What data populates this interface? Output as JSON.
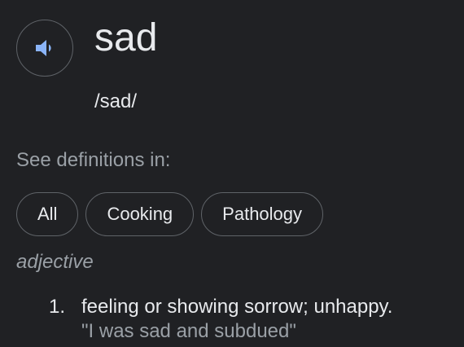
{
  "entry": {
    "word": "sad",
    "phonetic": "/sad/",
    "speaker_icon": "volume-speaker-icon",
    "icon_color": "#8ab4f8"
  },
  "definitions_filter": {
    "label": "See definitions in:",
    "chips": [
      {
        "label": "All"
      },
      {
        "label": "Cooking"
      },
      {
        "label": "Pathology"
      }
    ]
  },
  "part_of_speech": "adjective",
  "senses": [
    {
      "number": "1.",
      "definition": "feeling or showing sorrow; unhappy.",
      "example": "\"I was sad and subdued\""
    }
  ]
}
